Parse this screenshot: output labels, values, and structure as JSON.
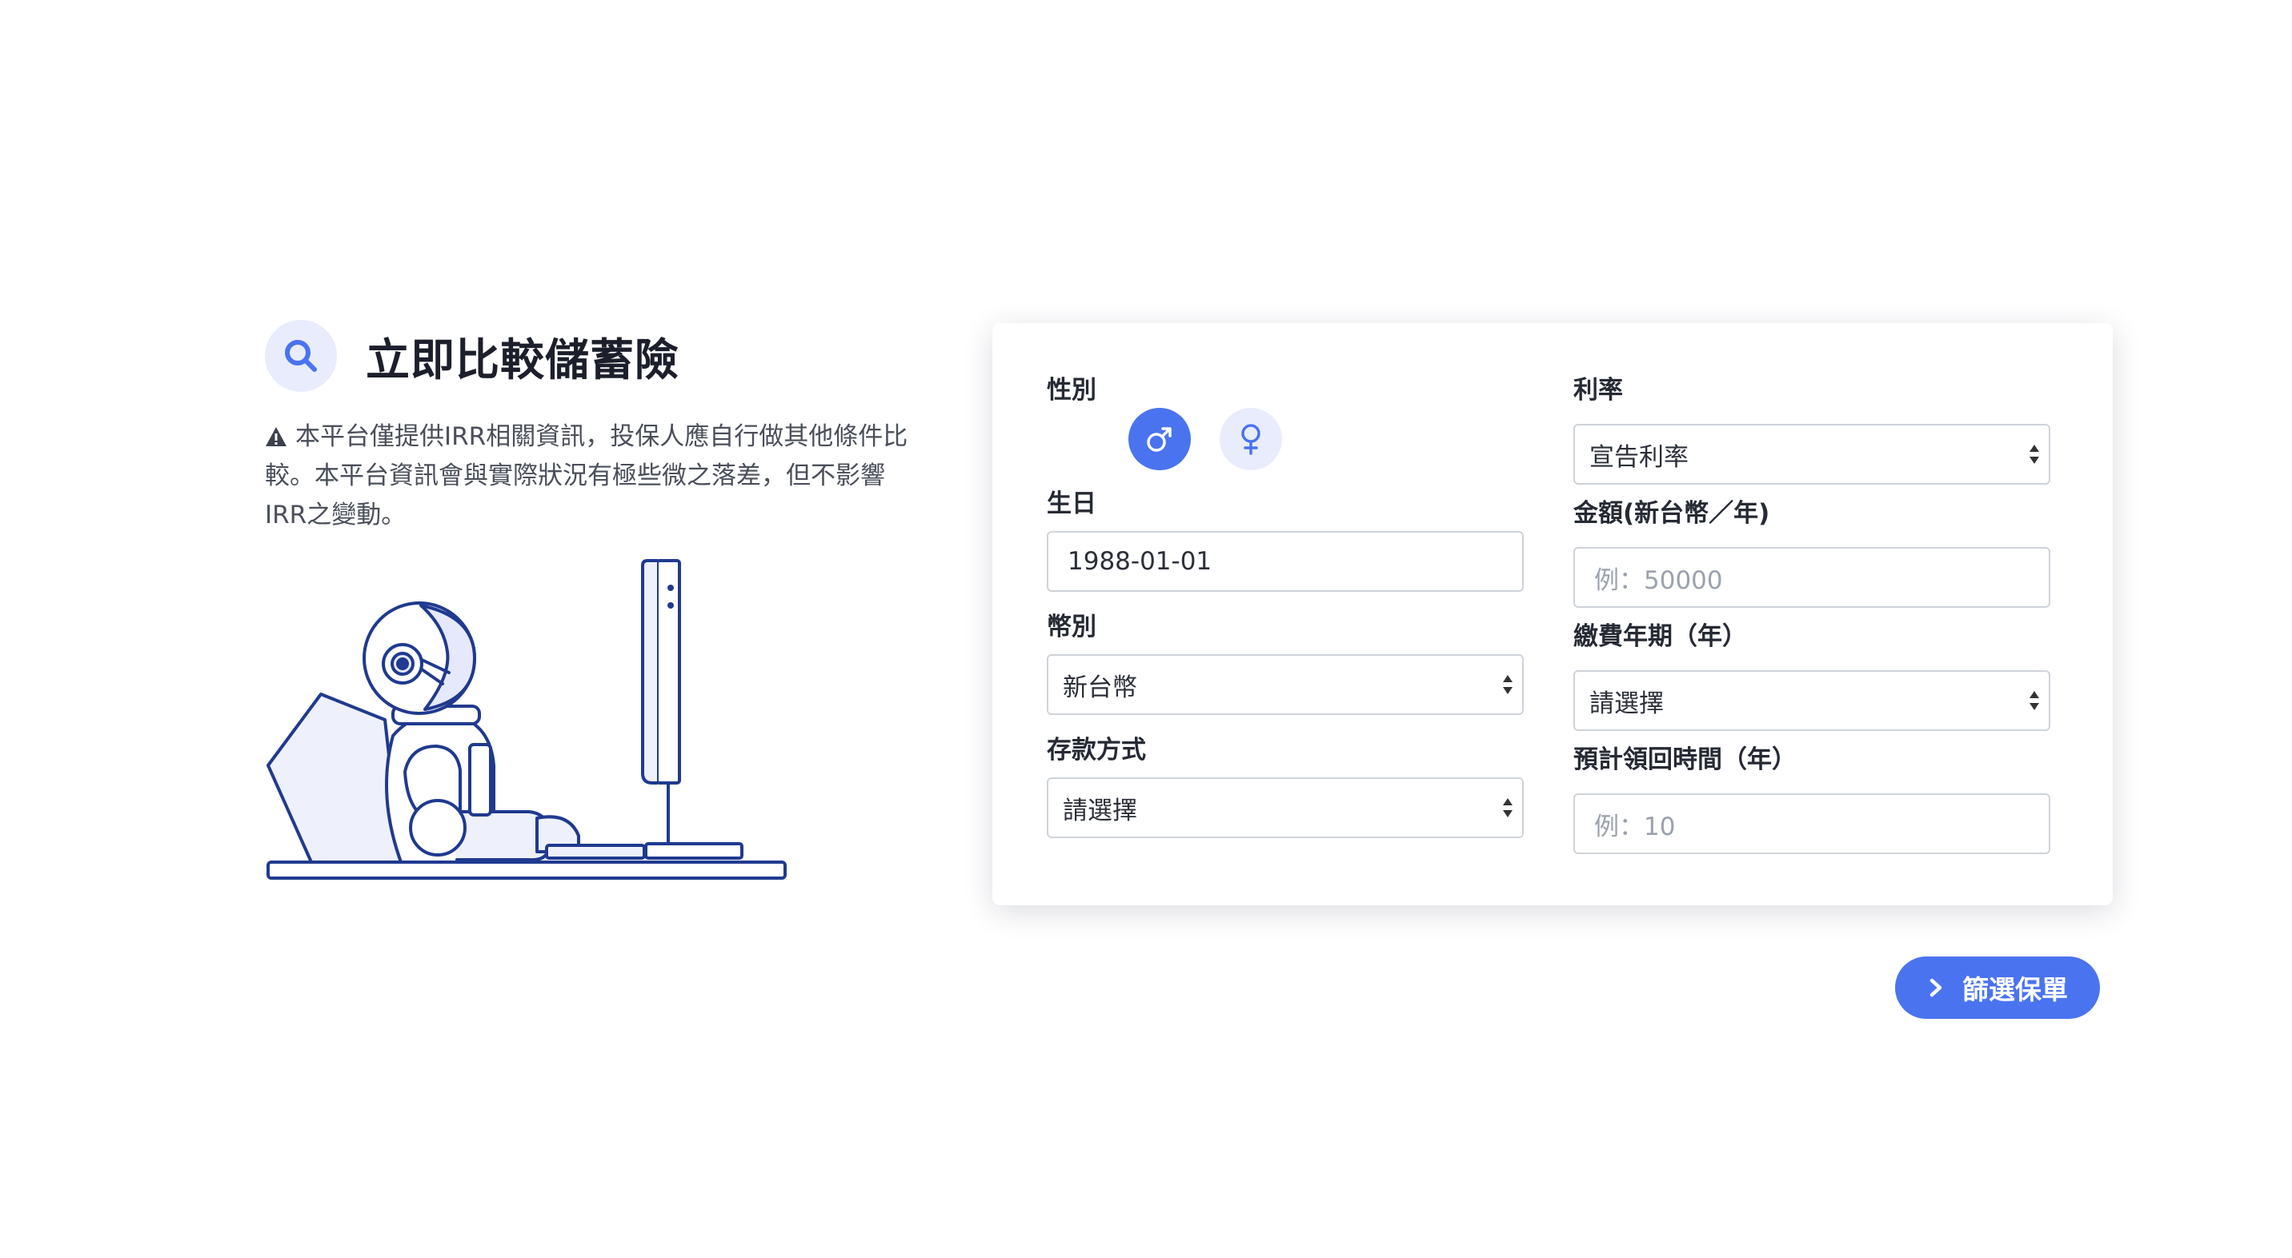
{
  "header": {
    "title": "立即比較儲蓄險",
    "notice": "本平台僅提供IRR相關資訊，投保人應自行做其他條件比較。本平台資訊會與實際狀況有極些微之落差，但不影響IRR之變動。"
  },
  "form": {
    "gender": {
      "label": "性別",
      "options": [
        {
          "name": "male",
          "icon": "male-icon",
          "symbol": "♂",
          "selected": true
        },
        {
          "name": "female",
          "icon": "female-icon",
          "symbol": "♀",
          "selected": false
        }
      ]
    },
    "birthday": {
      "label": "生日",
      "value": "1988-01-01"
    },
    "currency": {
      "label": "幣別",
      "value": "新台幣"
    },
    "deposit_method": {
      "label": "存款方式",
      "value": "請選擇"
    },
    "rate": {
      "label": "利率",
      "value": "宣告利率"
    },
    "amount": {
      "label": "金額(新台幣／年)",
      "placeholder": "例：50000"
    },
    "pay_years": {
      "label": "繳費年期（年）",
      "value": "請選擇"
    },
    "receive_time": {
      "label": "預計領回時間（年）",
      "placeholder": "例：10"
    }
  },
  "actions": {
    "filter_label": "篩選保單"
  },
  "colors": {
    "accent": "#4a73f0",
    "accent_light": "#e8ecfc",
    "illustration": "#1f3a8f"
  }
}
